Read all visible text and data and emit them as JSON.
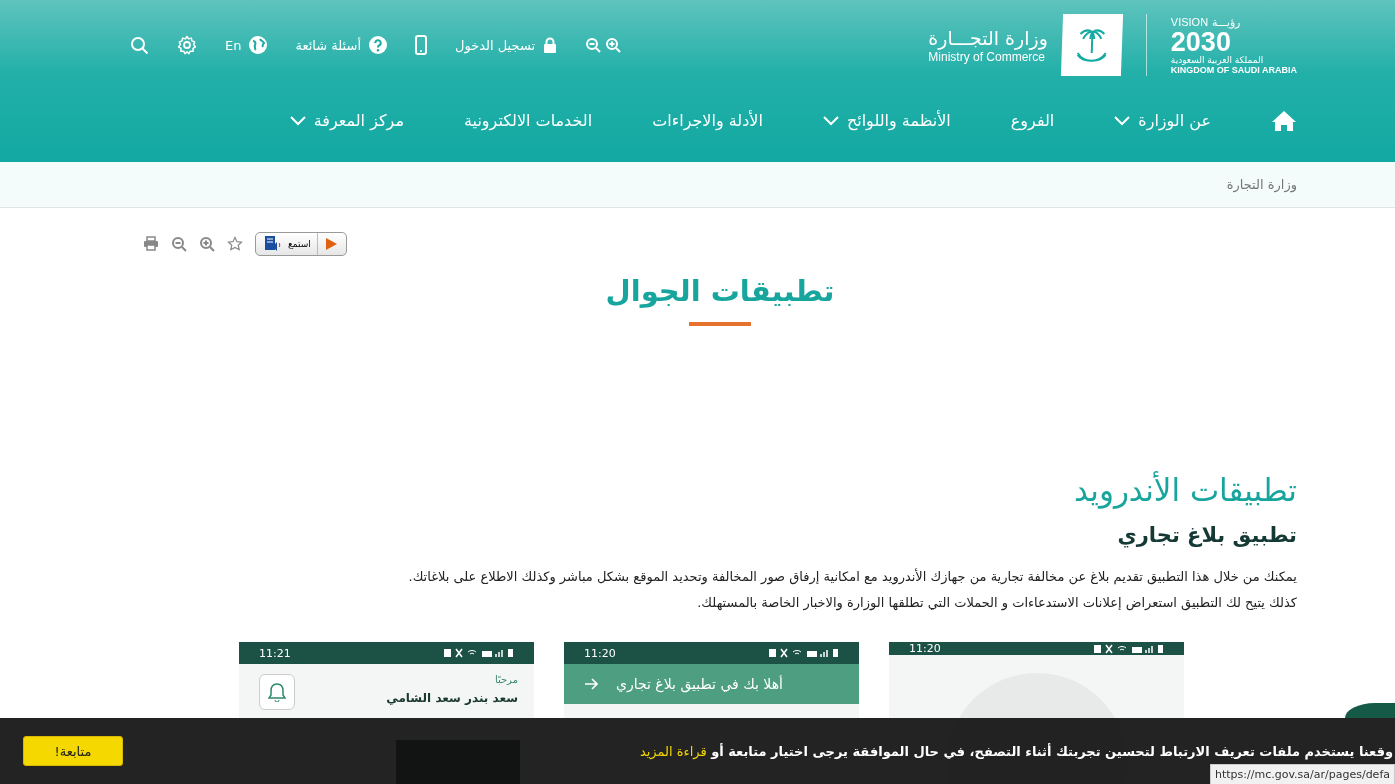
{
  "header": {
    "vision": {
      "word_ar": "رؤيـــة",
      "word_en": "VISION",
      "year": "2030",
      "country_ar": "المملكة العربية السعودية",
      "country_en": "KINGDOM OF SAUDI ARABIA"
    },
    "ministry": {
      "name_ar": "وزارة التجـــارة",
      "name_en": "Ministry of Commerce"
    },
    "utility": [
      {
        "kind": "zoom"
      },
      {
        "kind": "login",
        "label": "تسجيل الدخول"
      },
      {
        "kind": "mobile"
      },
      {
        "kind": "faq",
        "label": "أسئلة شائعة"
      },
      {
        "kind": "language",
        "label": "En"
      },
      {
        "kind": "settings"
      },
      {
        "kind": "search"
      }
    ],
    "nav": [
      {
        "kind": "home"
      },
      {
        "kind": "link",
        "label": "عن الوزارة",
        "dropdown": true
      },
      {
        "kind": "link",
        "label": "الفروع",
        "dropdown": false
      },
      {
        "kind": "link",
        "label": "الأنظمة واللوائح",
        "dropdown": true
      },
      {
        "kind": "link",
        "label": "الأدلة والاجراءات",
        "dropdown": false
      },
      {
        "kind": "link",
        "label": "الخدمات الالكترونية",
        "dropdown": false
      },
      {
        "kind": "link",
        "label": "مركز المعرفة",
        "dropdown": true
      }
    ]
  },
  "breadcrumb": [
    "وزارة التجارة"
  ],
  "page_tools": {
    "listen": "استمع"
  },
  "page_title": "تطبيقات الجوال",
  "section": {
    "title": "تطبيقات الأندرويد",
    "subtitle": "تطبيق بلاغ تجاري",
    "paragraphs": [
      "يمكنك من خلال هذا التطبيق تقديم بلاغ عن مخالفة تجارية من جهازك الأندرويد مع امكانية إرفاق صور المخالفة وتحديد الموقع بشكل مباشر وكذلك الاطلاع على بلاغاتك.",
      "كذلك يتيح لك التطبيق استعراض إعلانات الاستدعاءات و الحملات التي تطلقها الوزارة والاخبار الخاصة بالمستهلك."
    ]
  },
  "screenshots": [
    {
      "kind": "fingerprint",
      "time": "11:20"
    },
    {
      "kind": "welcome",
      "time": "11:20",
      "banner": "أهلا بك في تطبيق بلاغ تجاري"
    },
    {
      "kind": "home",
      "time": "11:21",
      "greeting": "مرحبًا",
      "user": "سعد بندر سعد الشامي"
    }
  ],
  "cookie_bar": {
    "text": "وقعنا يستخدم ملفات تعريف الارتباط لتحسين تجربتك أثناء التصفح، في حال الموافقة يرجى اختيار متابعة أو",
    "link": "قراءة المزيد",
    "button": "متابعة!"
  },
  "status_url": "https://mc.gov.sa/ar/pages/defa"
}
